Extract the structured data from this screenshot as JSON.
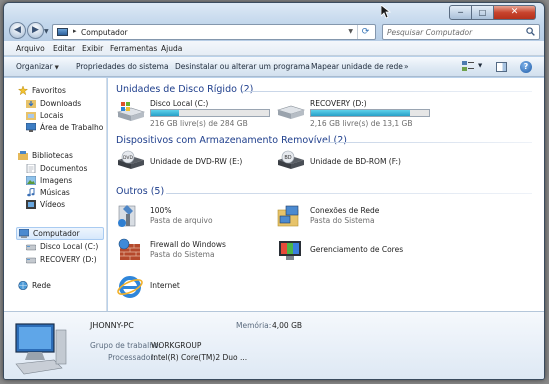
{
  "address": {
    "crumb": "Computador"
  },
  "search": {
    "placeholder": "Pesquisar Computador"
  },
  "window_controls": {
    "minimize": "─",
    "maximize": "□",
    "close": "✕"
  },
  "menu": [
    "Arquivo",
    "Editar",
    "Exibir",
    "Ferramentas",
    "Ajuda"
  ],
  "toolbar": {
    "organize": "Organizar",
    "system_properties": "Propriedades do sistema",
    "uninstall": "Desinstalar ou alterar um programa",
    "map_drive": "Mapear unidade de rede",
    "more": "»",
    "help": "?"
  },
  "nav": {
    "favorites": {
      "label": "Favoritos",
      "items": [
        "Downloads",
        "Locais",
        "Área de Trabalho"
      ]
    },
    "libraries": {
      "label": "Bibliotecas",
      "items": [
        "Documentos",
        "Imagens",
        "Músicas",
        "Vídeos"
      ]
    },
    "computer": {
      "label": "Computador",
      "items": [
        "Disco Local (C:)",
        "RECOVERY (D:)"
      ]
    },
    "network": {
      "label": "Rede"
    }
  },
  "groups": {
    "hard_disks": {
      "title": "Unidades de Disco Rígido (2)",
      "items": [
        {
          "name": "Disco Local (C:)",
          "free": "216 GB livre(s) de 284 GB",
          "used_fraction": 0.24
        },
        {
          "name": "RECOVERY (D:)",
          "free": "2,16 GB livre(s) de 13,1 GB",
          "used_fraction": 0.84
        }
      ]
    },
    "removable": {
      "title": "Dispositivos com Armazenamento Removível (2)",
      "items": [
        {
          "name": "Unidade de DVD-RW (E:)",
          "icon": "dvd-drive-icon",
          "badge": "DVD"
        },
        {
          "name": "Unidade de BD-ROM (F:)",
          "icon": "bd-drive-icon",
          "badge": "BD"
        }
      ]
    },
    "others": {
      "title": "Outros (5)",
      "items": [
        {
          "name": "100%",
          "sub": "Pasta de arquivo"
        },
        {
          "name": "Conexões de Rede",
          "sub": "Pasta do Sistema"
        },
        {
          "name": "Firewall do Windows",
          "sub": "Pasta do Sistema"
        },
        {
          "name": "Gerenciamento de Cores",
          "sub": ""
        },
        {
          "name": "Internet",
          "sub": ""
        }
      ]
    }
  },
  "details": {
    "pc_name": "JHONNY-PC",
    "memory_label": "Memória:",
    "memory_value": "4,00 GB",
    "workgroup_label": "Grupo de trabalho:",
    "workgroup_value": "WORKGROUP",
    "processor_label": "Processador:",
    "processor_value": "Intel(R) Core(TM)2 Duo ..."
  },
  "colors": {
    "group_header": "#1e3e8c",
    "bar_fill": "#26a0c8",
    "close_button": "#c8442d"
  }
}
